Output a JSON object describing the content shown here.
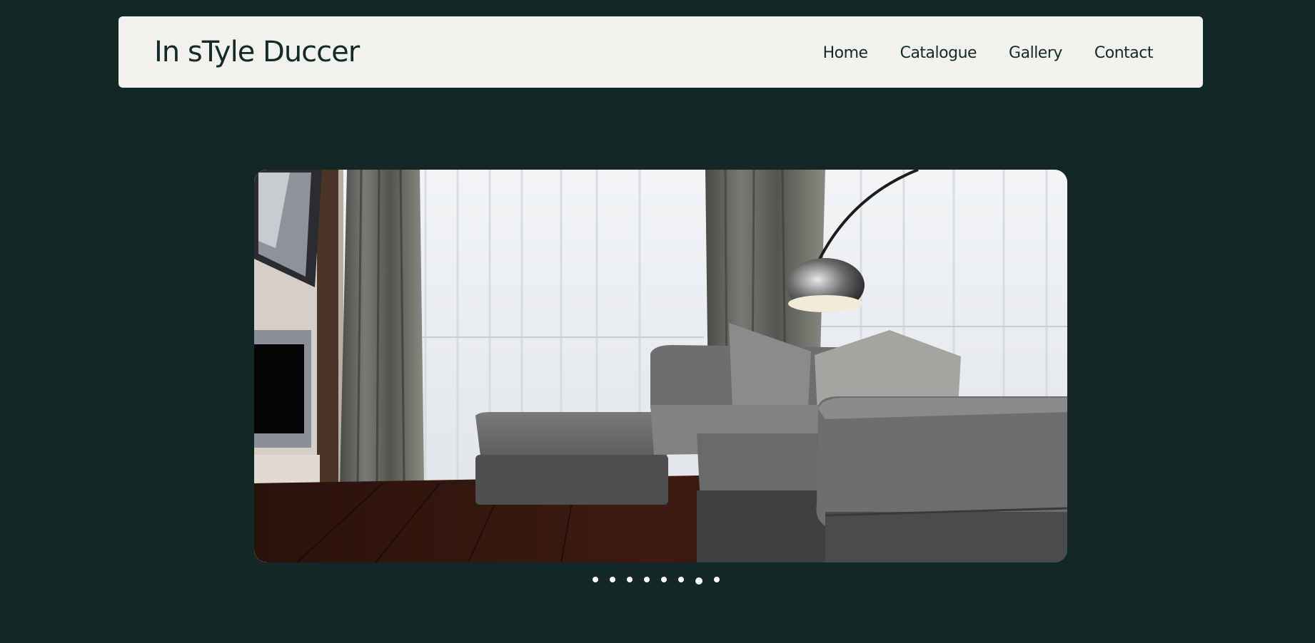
{
  "header": {
    "brand": "In sTyle Duccer",
    "nav": [
      {
        "label": "Home"
      },
      {
        "label": "Catalogue"
      },
      {
        "label": "Gallery"
      },
      {
        "label": "Contact"
      }
    ]
  },
  "slider": {
    "image_subject": "living room with grey sectional sofa, arc floor lamp, sheer curtains and dark wood floor",
    "slide_count": 8,
    "active_index": 6
  },
  "colors": {
    "background": "#112824",
    "header_bg": "#f1f2ee",
    "text": "#142a25",
    "dots": "#ffffff"
  }
}
